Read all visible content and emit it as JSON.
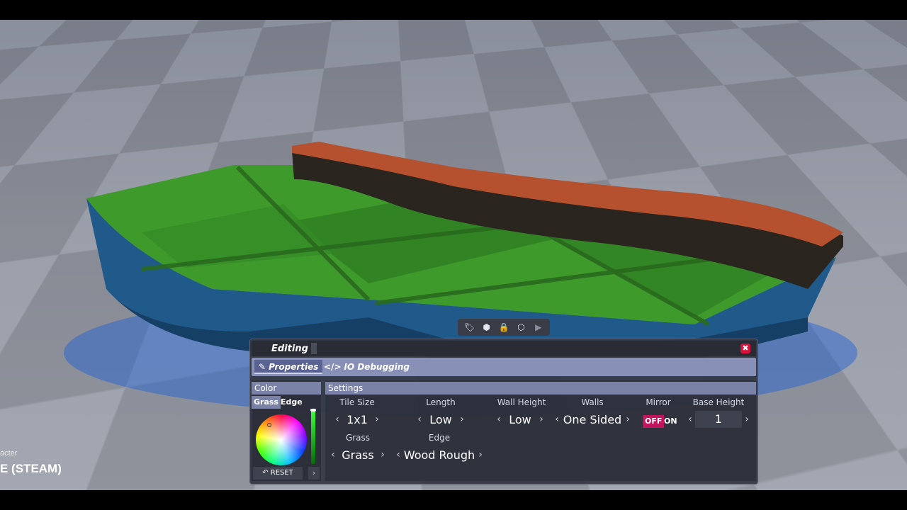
{
  "hud": {
    "sub_label": "acter",
    "main_label": "E (STEAM)"
  },
  "toolbar": {
    "icons": [
      "tag-icon",
      "physics-icon",
      "lock-icon",
      "cube-icon",
      "play-icon"
    ],
    "glyphs": [
      "🏷",
      "⬢",
      "🔒",
      "⬡",
      "▶"
    ]
  },
  "panel": {
    "title": "Editing",
    "close_glyph": "✖",
    "tabs": [
      {
        "label": "Properties",
        "glyph": "✎",
        "active": true
      },
      {
        "label": "IO Debugging",
        "glyph": "</>",
        "active": false
      }
    ],
    "color": {
      "header": "Color",
      "tabs": [
        "Grass",
        "Edge"
      ],
      "reset_label": "RESET",
      "reset_glyph": "↶",
      "expand_glyph": "›"
    },
    "settings": {
      "header": "Settings",
      "tile_size": {
        "label": "Tile Size",
        "value": "1x1"
      },
      "length": {
        "label": "Length",
        "value": "Low"
      },
      "wall_height": {
        "label": "Wall Height",
        "value": "Low"
      },
      "walls": {
        "label": "Walls",
        "value": "One Sided"
      },
      "mirror": {
        "label": "Mirror",
        "off": "OFF",
        "on": "ON",
        "state": "OFF"
      },
      "base_height": {
        "label": "Base Height",
        "value": "1"
      },
      "grass": {
        "label": "Grass",
        "value": "Grass"
      },
      "edge": {
        "label": "Edge",
        "value": "Wood Rough"
      }
    },
    "arrow_left": "‹",
    "arrow_right": "›"
  },
  "colors": {
    "grass": "#3f9a2c",
    "wall": "#1f5a8a",
    "plank": "#b5512e",
    "accent": "#c3155e"
  }
}
